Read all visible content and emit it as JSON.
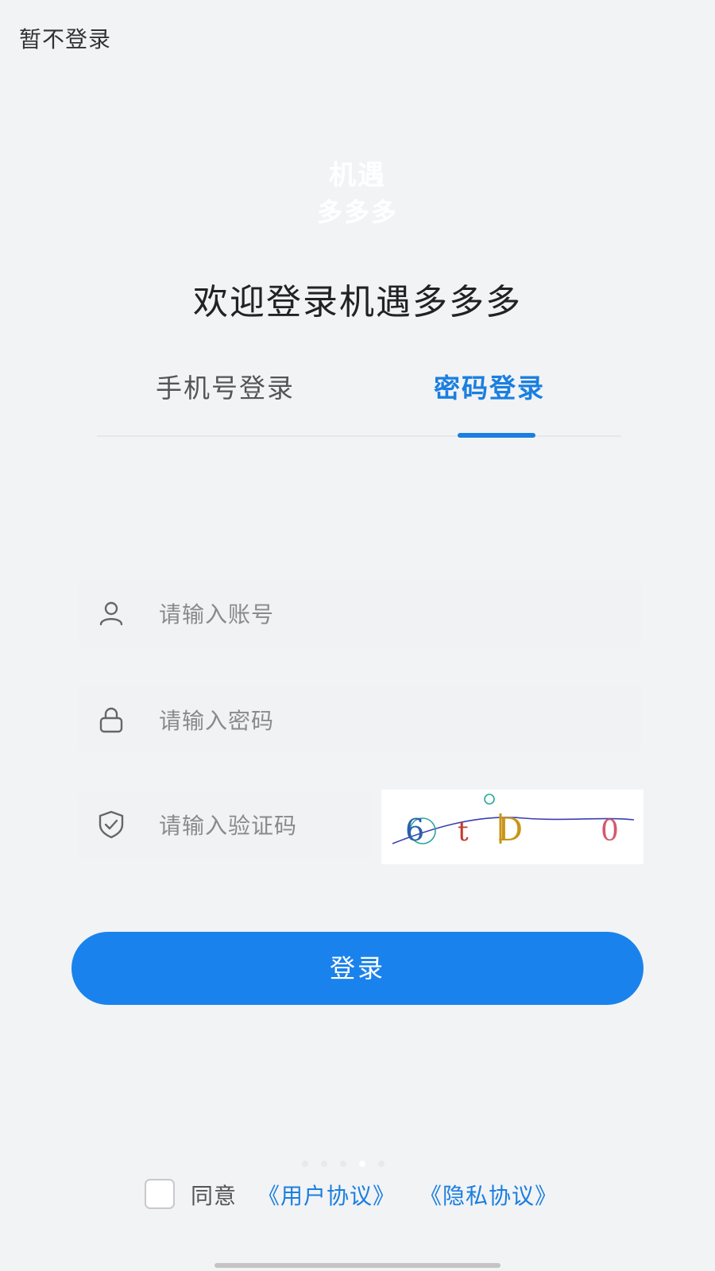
{
  "header": {
    "skip_label": "暂不登录"
  },
  "logo": {
    "line1": "机遇",
    "line2": "多多多"
  },
  "welcome": "欢迎登录机遇多多多",
  "tabs": [
    {
      "label": "手机号登录",
      "active": false
    },
    {
      "label": "密码登录",
      "active": true
    }
  ],
  "form": {
    "account": {
      "icon": "user-icon",
      "placeholder": "请输入账号",
      "value": ""
    },
    "password": {
      "icon": "lock-icon",
      "placeholder": "请输入密码",
      "value": ""
    },
    "captcha": {
      "icon": "shield-check-icon",
      "placeholder": "请输入验证码",
      "value": "",
      "image_chars": [
        "6",
        "t",
        "D",
        "0"
      ]
    }
  },
  "login_button": "登录",
  "agreement": {
    "checked": false,
    "text": "同意",
    "user_agreement": "《用户协议》",
    "privacy_agreement": "《隐私协议》"
  },
  "carousel": {
    "count": 5,
    "active_index": 3
  },
  "colors": {
    "accent": "#1a7fe0",
    "button": "#1a82ec",
    "background": "#f2f3f5",
    "text_primary": "#222222",
    "placeholder": "#8a8a8a"
  }
}
